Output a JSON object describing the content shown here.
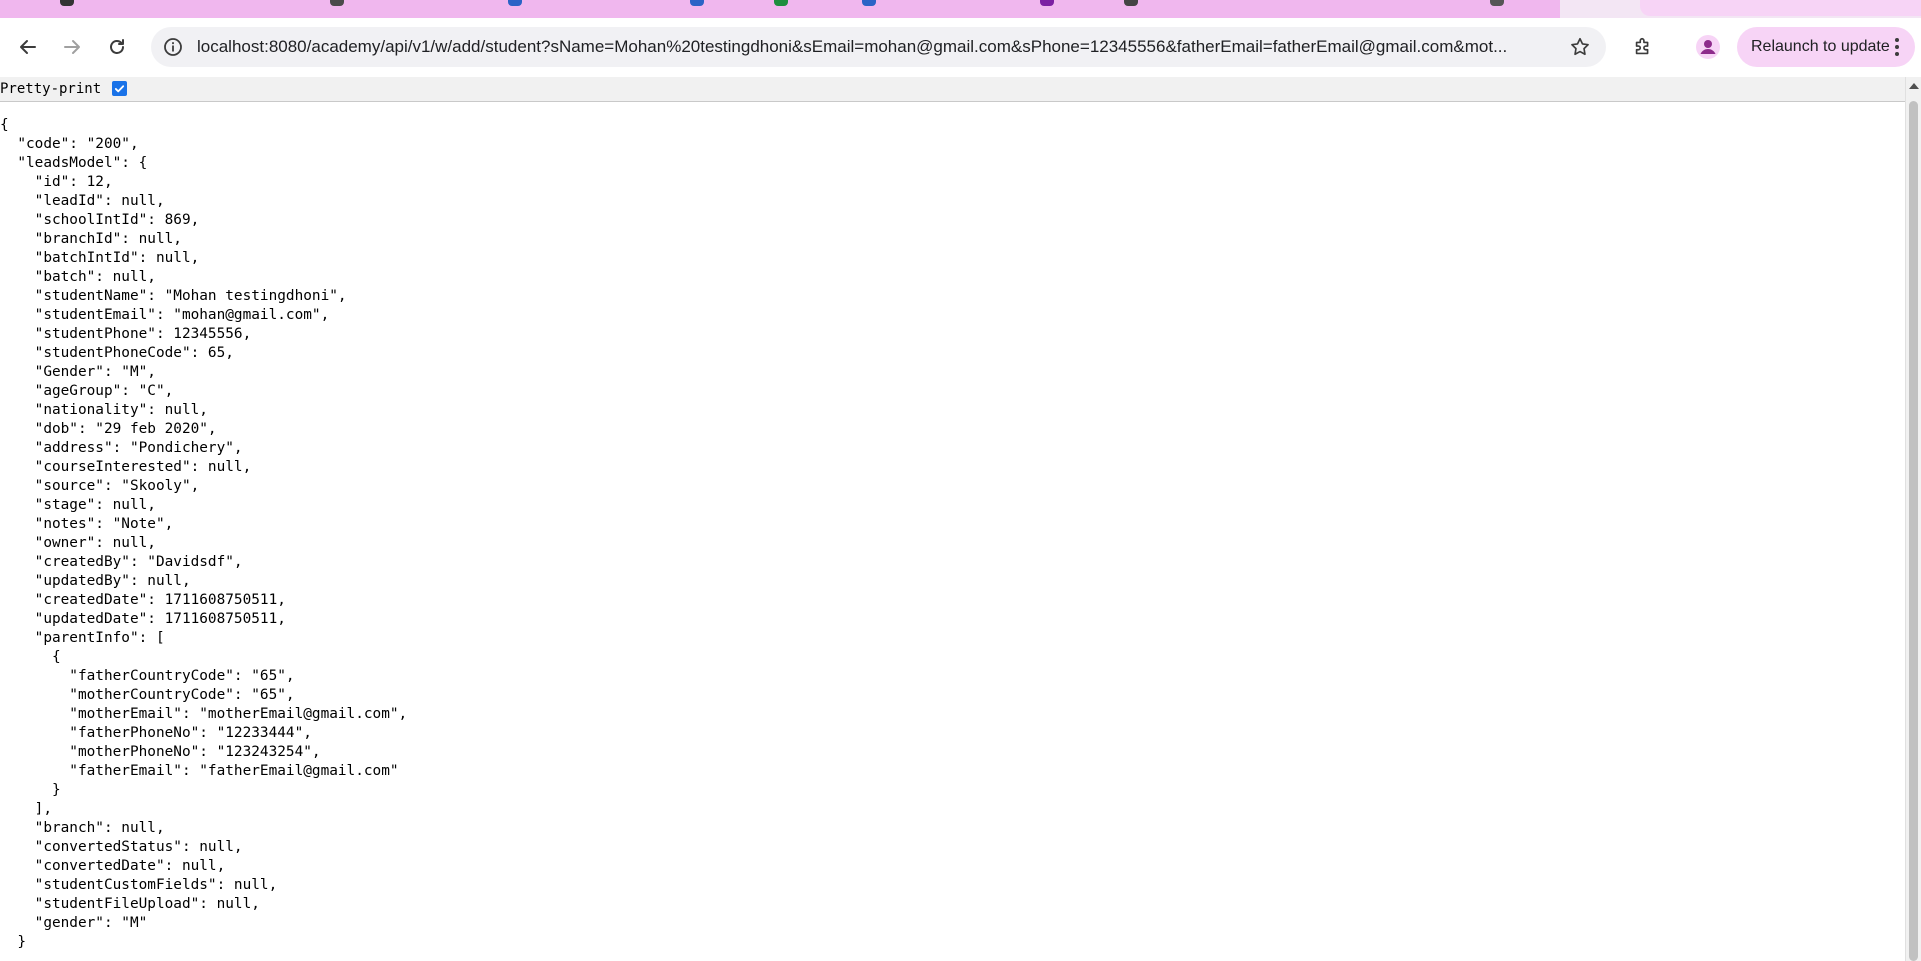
{
  "browser": {
    "address_url": "localhost:8080/academy/api/v1/w/add/student?sName=Mohan%20testingdhoni&sEmail=mohan@gmail.com&sPhone=12345556&fatherEmail=fatherEmail@gmail.com&mot...",
    "relaunch_label": "Relaunch to update",
    "accent_color": "#f7d4f6",
    "icons": {
      "back": "back-arrow-icon",
      "forward": "forward-arrow-icon",
      "reload": "reload-icon",
      "site_info": "site-info-icon",
      "bookmark": "star-icon",
      "extensions": "puzzle-icon",
      "profile": "person-icon",
      "menu": "kebab-menu-icon"
    }
  },
  "viewer": {
    "pretty_print_label": "Pretty-print",
    "pretty_print_checked": true
  },
  "json_lines": [
    "{",
    "  \"code\": \"200\",",
    "  \"leadsModel\": {",
    "    \"id\": 12,",
    "    \"leadId\": null,",
    "    \"schoolIntId\": 869,",
    "    \"branchId\": null,",
    "    \"batchIntId\": null,",
    "    \"batch\": null,",
    "    \"studentName\": \"Mohan testingdhoni\",",
    "    \"studentEmail\": \"mohan@gmail.com\",",
    "    \"studentPhone\": 12345556,",
    "    \"studentPhoneCode\": 65,",
    "    \"Gender\": \"M\",",
    "    \"ageGroup\": \"C\",",
    "    \"nationality\": null,",
    "    \"dob\": \"29 feb 2020\",",
    "    \"address\": \"Pondichery\",",
    "    \"courseInterested\": null,",
    "    \"source\": \"Skooly\",",
    "    \"stage\": null,",
    "    \"notes\": \"Note\",",
    "    \"owner\": null,",
    "    \"createdBy\": \"Davidsdf\",",
    "    \"updatedBy\": null,",
    "    \"createdDate\": 1711608750511,",
    "    \"updatedDate\": 1711608750511,",
    "    \"parentInfo\": [",
    "      {",
    "        \"fatherCountryCode\": \"65\",",
    "        \"motherCountryCode\": \"65\",",
    "        \"motherEmail\": \"motherEmail@gmail.com\",",
    "        \"fatherPhoneNo\": \"12233444\",",
    "        \"motherPhoneNo\": \"123243254\",",
    "        \"fatherEmail\": \"fatherEmail@gmail.com\"",
    "      }",
    "    ],",
    "    \"branch\": null,",
    "    \"convertedStatus\": null,",
    "    \"convertedDate\": null,",
    "    \"studentCustomFields\": null,",
    "    \"studentFileUpload\": null,",
    "    \"gender\": \"M\"",
    "  }"
  ]
}
